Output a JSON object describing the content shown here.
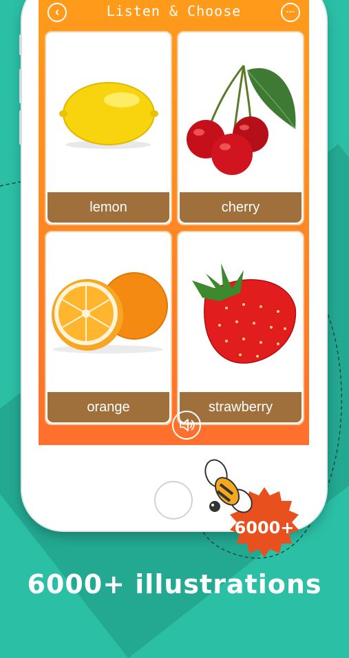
{
  "app": {
    "title": "Listen & Choose"
  },
  "header": {
    "back_icon": "chevron-left-icon",
    "more_icon": "ellipsis-icon"
  },
  "cards": [
    {
      "label": "lemon",
      "icon": "lemon-image"
    },
    {
      "label": "cherry",
      "icon": "cherry-image"
    },
    {
      "label": "orange",
      "icon": "orange-image"
    },
    {
      "label": "strawberry",
      "icon": "strawberry-image"
    }
  ],
  "controls": {
    "speaker_icon": "speaker-icon"
  },
  "promo": {
    "badge": "6000+",
    "caption": "6000+ illustrations"
  },
  "colors": {
    "background": "#2bbfa6",
    "screen_top": "#ff9b1a",
    "screen_bottom": "#ff6f2e",
    "card_label": "#a0703c",
    "badge": "#e8501e"
  }
}
